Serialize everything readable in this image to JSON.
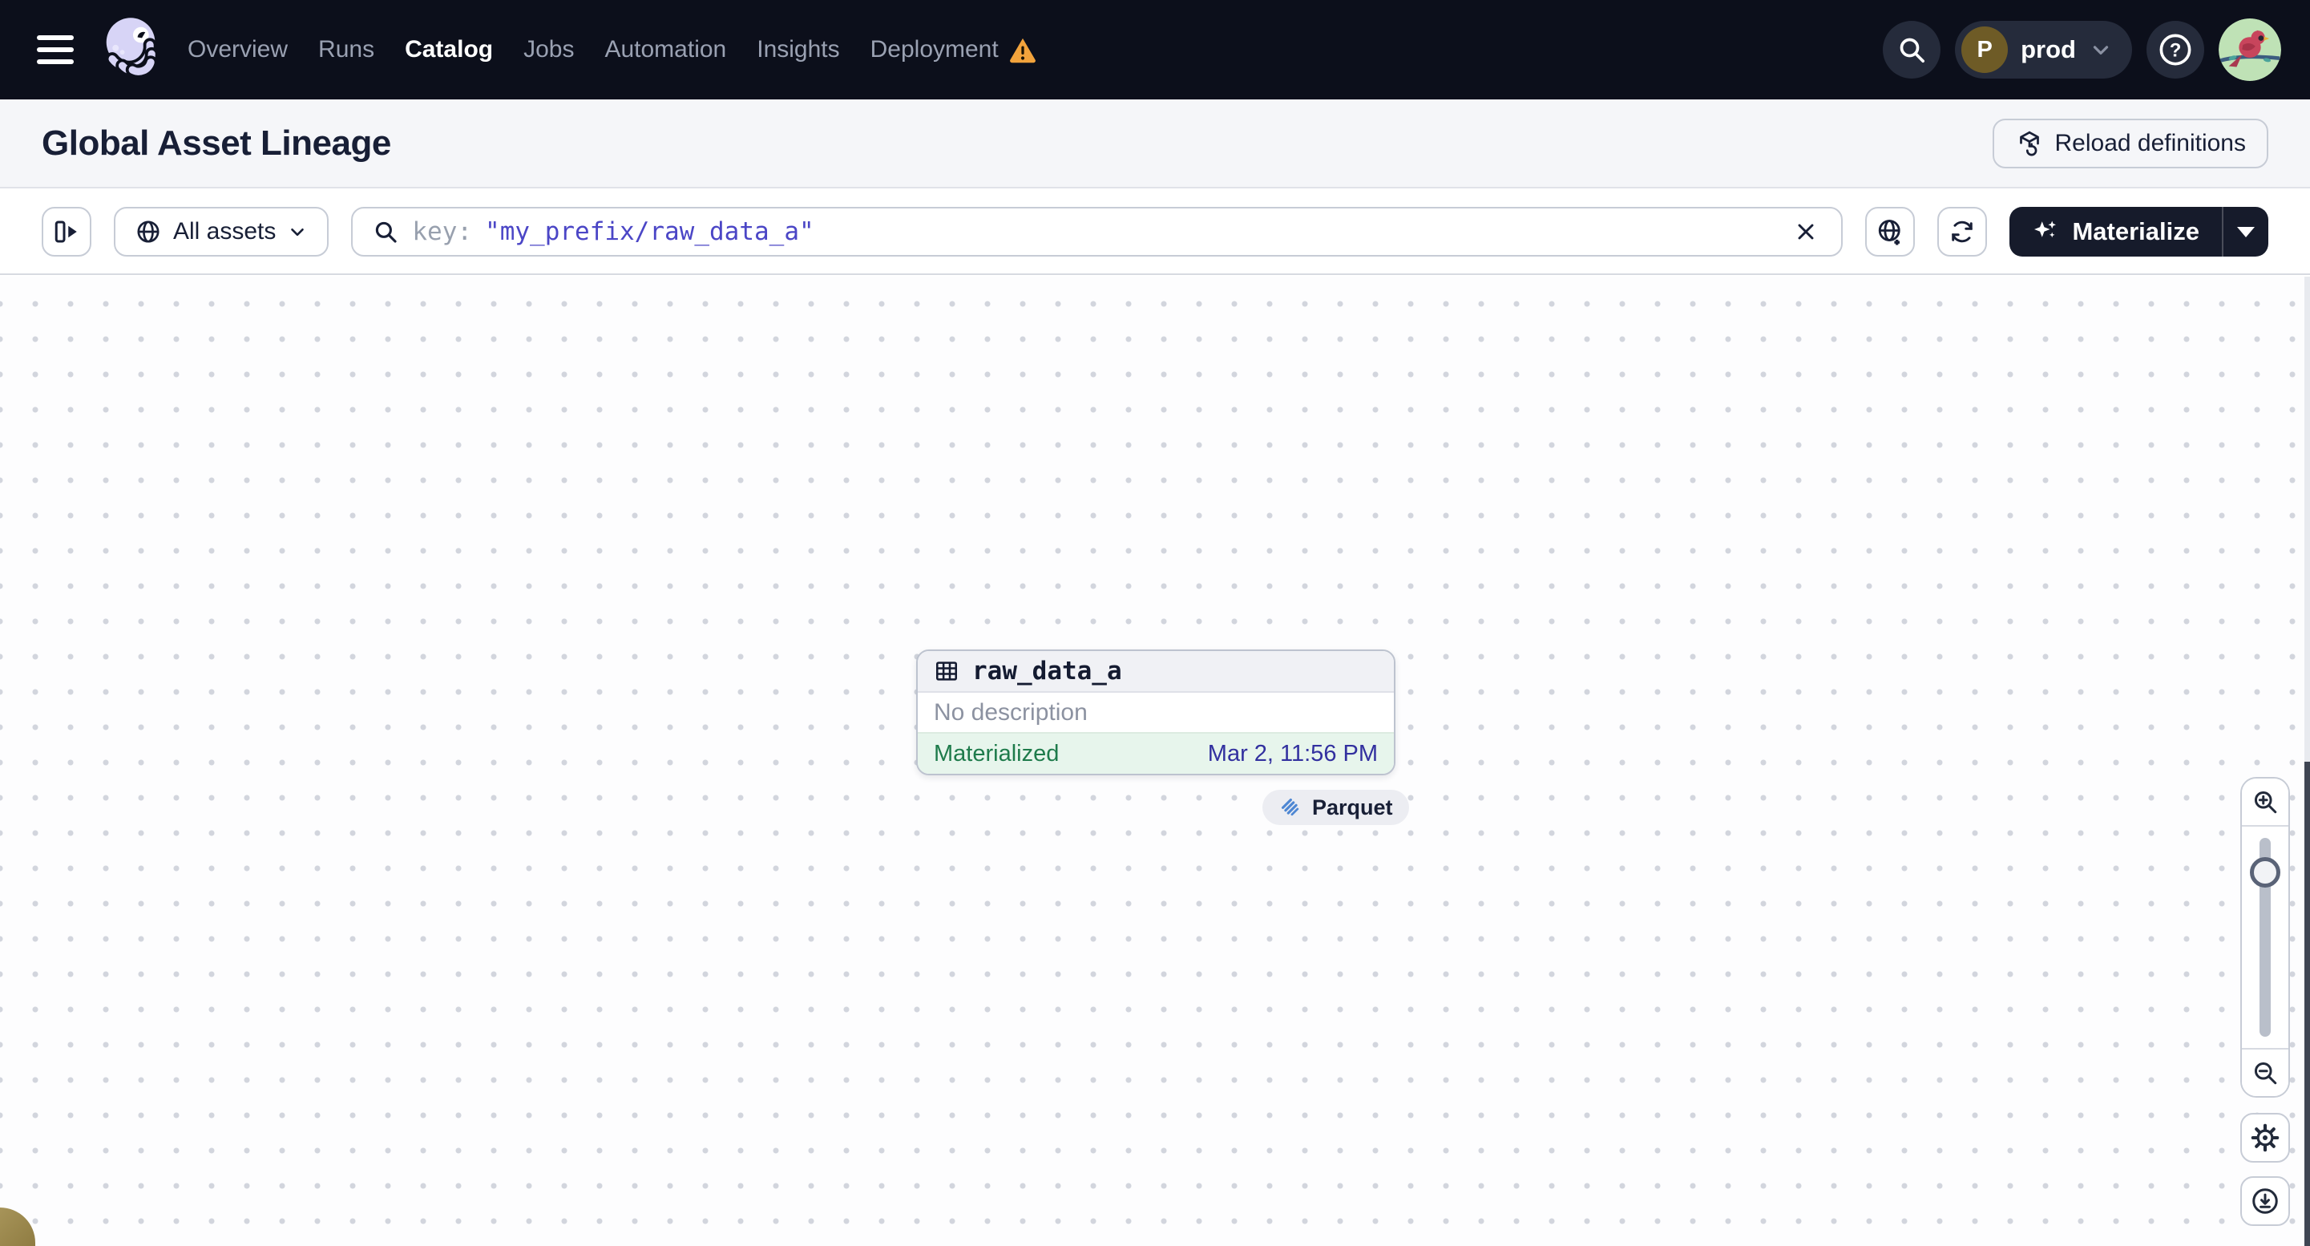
{
  "topnav": {
    "items": [
      {
        "label": "Overview",
        "active": false
      },
      {
        "label": "Runs",
        "active": false
      },
      {
        "label": "Catalog",
        "active": true
      },
      {
        "label": "Jobs",
        "active": false
      },
      {
        "label": "Automation",
        "active": false
      },
      {
        "label": "Insights",
        "active": false
      },
      {
        "label": "Deployment",
        "active": false,
        "warning": true
      }
    ],
    "env": {
      "initial": "P",
      "name": "prod"
    }
  },
  "header": {
    "title": "Global Asset Lineage",
    "reload_label": "Reload definitions"
  },
  "toolbar": {
    "filter_label": "All assets",
    "search_prefix": "key:",
    "search_value": "\"my_prefix/raw_data_a\"",
    "materialize_label": "Materialize"
  },
  "graph": {
    "node": {
      "name": "raw_data_a",
      "description": "No description",
      "status": "Materialized",
      "timestamp": "Mar 2, 11:56 PM",
      "tag": "Parquet"
    }
  },
  "icons_glyphs": {
    "question": "?"
  },
  "icons": {
    "menu-icon": "hamburger three bars",
    "dagster-logo": "lavender octopus",
    "warning-icon": "orange triangle with exclamation",
    "search-icon": "magnifier",
    "chevron-down-icon": "v chevron",
    "help-icon": "circled question mark",
    "avatar": "cardinal bird on green",
    "reload-icon": "cube with circular arrow",
    "panel-toggle-icon": "expand side panel",
    "globe-icon": "globe",
    "clear-icon": "x cross",
    "add-scope-icon": "globe with plus",
    "refresh-icon": "circular sync arrows",
    "materialize-icon": "sparkles",
    "table-icon": "grid table",
    "parquet-icon": "blue striped diamond",
    "zoom-in-icon": "magnifier plus",
    "zoom-out-icon": "magnifier minus",
    "settings-icon": "gear",
    "download-icon": "circled down arrow"
  },
  "colors": {
    "topnav_bg": "#0c0f1b",
    "accent_indigo": "#4b46c6",
    "status_green_text": "#1e7b4b",
    "status_green_bg": "#e7f5ec",
    "timestamp_indigo": "#32309f",
    "warning_orange": "#f2a33c",
    "materialize_bg": "#161b2b",
    "parquet_blue": "#4e87d3",
    "env_avatar_brown": "#6e5b26"
  }
}
